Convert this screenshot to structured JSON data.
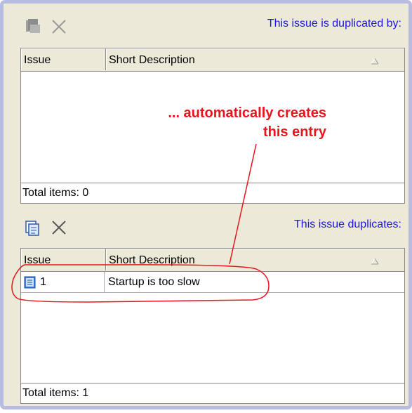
{
  "top_panel": {
    "title": "This issue is duplicated by:",
    "columns": [
      "Issue",
      "Short Description"
    ],
    "total_label": "Total items: 0"
  },
  "bottom_panel": {
    "title": "This issue duplicates:",
    "columns": [
      "Issue",
      "Short Description"
    ],
    "rows": [
      {
        "issue": "1",
        "description": "Startup is too slow"
      }
    ],
    "total_label": "Total items: 1"
  },
  "annotation": {
    "line1": "... automatically creates",
    "line2": "this entry",
    "color": "#e8141e"
  },
  "colors": {
    "title_blue": "#1c14e8",
    "panel_bg": "#ece9d8",
    "frame_border": "#b8bce0"
  },
  "icons": {
    "top_add": "disabled-add-issue-icon",
    "top_remove": "remove-icon",
    "bottom_add": "add-issue-icon",
    "bottom_remove": "remove-icon",
    "row_issue": "issue-document-icon",
    "sort": "sort-ascending-icon"
  }
}
